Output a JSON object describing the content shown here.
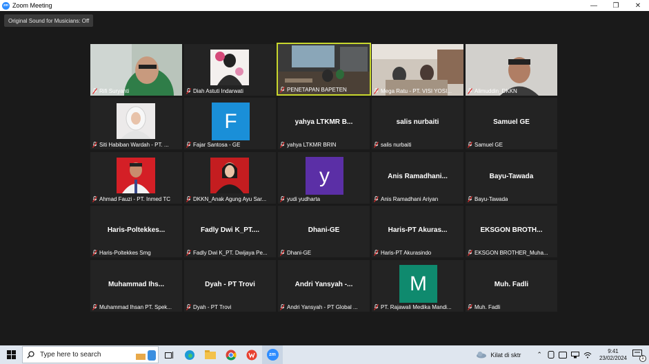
{
  "window": {
    "title": "Zoom Meeting",
    "minimize": "—",
    "restore": "❐",
    "close": "✕"
  },
  "meeting": {
    "original_sound": "Original Sound for Musicians: Off"
  },
  "tiles": [
    {
      "label": "Rifi Suryanti"
    },
    {
      "label": "Diah Astuti Indarwati"
    },
    {
      "label": "PENETAPAN BAPETEN"
    },
    {
      "label": "Mega Ratu - PT. VISI YOSI..."
    },
    {
      "label": "Alimuddin_DKKN"
    },
    {
      "label": "Siti Habiban Wardah - PT. ..."
    },
    {
      "label": "Fajar Santosa - GE",
      "letter": "F",
      "color": "#1a8fd8"
    },
    {
      "label": "yahya LTKMR BRIN",
      "display": "yahya LTKMR B..."
    },
    {
      "label": "salis nurbaiti",
      "display": "salis nurbaiti"
    },
    {
      "label": "Samuel GE",
      "display": "Samuel GE"
    },
    {
      "label": "Ahmad Fauzi - PT. Inmed TC"
    },
    {
      "label": "DKKN_Anak Agung Ayu Sar..."
    },
    {
      "label": "yudi yudharta",
      "letter": "y",
      "color": "#5b2fa6"
    },
    {
      "label": "Anis Ramadhani Ariyan",
      "display": "Anis Ramadhani..."
    },
    {
      "label": "Bayu-Tawada",
      "display": "Bayu-Tawada"
    },
    {
      "label": "Haris-Poltekkes Smg",
      "display": "Haris-Poltekkes..."
    },
    {
      "label": "Fadly Dwi K_PT. Dwijaya Pe...",
      "display": "Fadly Dwi K_PT...."
    },
    {
      "label": "Dhani-GE",
      "display": "Dhani-GE"
    },
    {
      "label": "Haris-PT Akurasindo",
      "display": "Haris-PT Akuras..."
    },
    {
      "label": "EKSGON BROTHER_Muha...",
      "display": "EKSGON BROTH..."
    },
    {
      "label": "Muhammad Ihsan PT. Spek...",
      "display": "Muhammad Ihs..."
    },
    {
      "label": "Dyah - PT Trovi",
      "display": "Dyah - PT Trovi"
    },
    {
      "label": "Andri Yansyah - PT Global ...",
      "display": "Andri Yansyah -..."
    },
    {
      "label": "PT. Rajawali Medika Mandi...",
      "letter": "M",
      "color": "#0f8a6e"
    },
    {
      "label": "Muh. Fadli",
      "display": "Muh. Fadli"
    }
  ],
  "taskbar": {
    "search_placeholder": "Type here to search",
    "weather": "Kilat di sktr",
    "time": "9:41",
    "date": "23/02/2024",
    "notif_count": "1",
    "zoom_label": "zm"
  },
  "colors": {
    "active_border": "#c9d82e",
    "tile_bg": "#232323",
    "stage_bg": "#1a1a1a",
    "mute_red": "#e02828"
  }
}
